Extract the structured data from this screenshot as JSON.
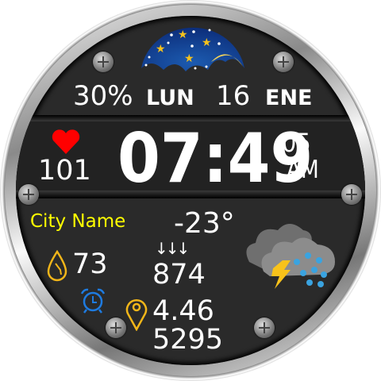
{
  "top": {
    "battery": "30%",
    "weekday": "LUN",
    "day": "16",
    "month": "ENE",
    "moon_icon": "moon-phase-icon"
  },
  "heart": {
    "icon": "heart-icon",
    "value": "101"
  },
  "time": {
    "hm": "07:49",
    "seconds": "05",
    "ampm": "AM"
  },
  "weather": {
    "city": "City Name",
    "temperature": "-23°",
    "icon": "thunderstorm-rain-icon"
  },
  "stats": {
    "humidity": "73",
    "pressure_arrows": "↓↓↓",
    "pressure": "874",
    "distance": "4.46",
    "steps": "5295"
  },
  "colors": {
    "city": "#ffff00",
    "accent": "#f2b619",
    "alarm": "#1e7be0",
    "heart": "#ff0000"
  }
}
